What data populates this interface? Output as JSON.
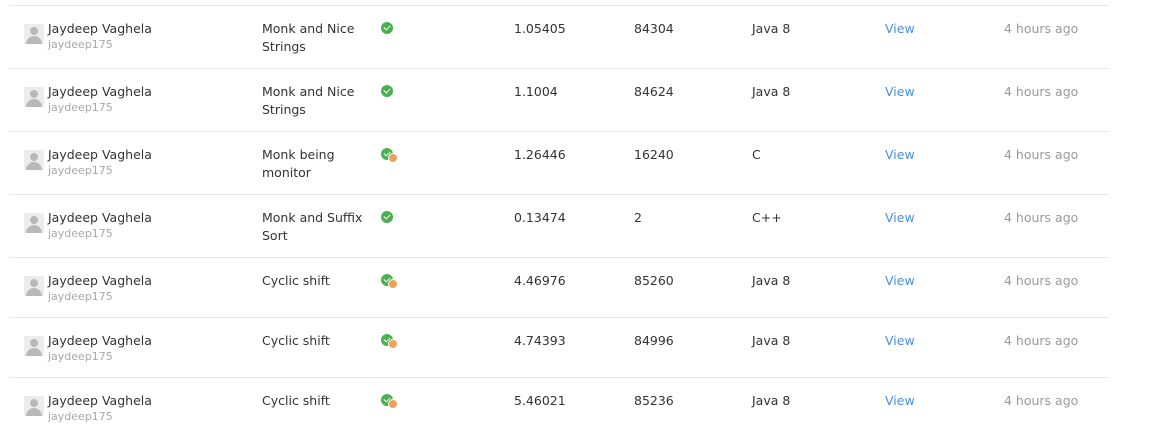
{
  "colors": {
    "accent_link": "#4a90d9",
    "accepted": "#4caf50",
    "partial": "#f0a05a",
    "divider": "#e6e6e6",
    "muted_text": "#9a9a9a"
  },
  "rows": [
    {
      "user_name": "Jaydeep Vaghela",
      "user_handle": "jaydeep175",
      "problem": "Monk and Nice Strings",
      "status_icon": "accepted-icon",
      "time": "1.05405",
      "memory": "84304",
      "language": "Java 8",
      "view_label": "View",
      "submitted": "4 hours ago"
    },
    {
      "user_name": "Jaydeep Vaghela",
      "user_handle": "jaydeep175",
      "problem": "Monk and Nice Strings",
      "status_icon": "accepted-icon",
      "time": "1.1004",
      "memory": "84624",
      "language": "Java 8",
      "view_label": "View",
      "submitted": "4 hours ago"
    },
    {
      "user_name": "Jaydeep Vaghela",
      "user_handle": "jaydeep175",
      "problem": "Monk being monitor",
      "status_icon": "partially-accepted-icon",
      "time": "1.26446",
      "memory": "16240",
      "language": "C",
      "view_label": "View",
      "submitted": "4 hours ago"
    },
    {
      "user_name": "Jaydeep Vaghela",
      "user_handle": "jaydeep175",
      "problem": "Monk and Suffix Sort",
      "status_icon": "accepted-icon",
      "time": "0.13474",
      "memory": "2",
      "language": "C++",
      "view_label": "View",
      "submitted": "4 hours ago"
    },
    {
      "user_name": "Jaydeep Vaghela",
      "user_handle": "jaydeep175",
      "problem": "Cyclic shift",
      "status_icon": "partially-accepted-icon",
      "time": "4.46976",
      "memory": "85260",
      "language": "Java 8",
      "view_label": "View",
      "submitted": "4 hours ago"
    },
    {
      "user_name": "Jaydeep Vaghela",
      "user_handle": "jaydeep175",
      "problem": "Cyclic shift",
      "status_icon": "partially-accepted-icon",
      "time": "4.74393",
      "memory": "84996",
      "language": "Java 8",
      "view_label": "View",
      "submitted": "4 hours ago"
    },
    {
      "user_name": "Jaydeep Vaghela",
      "user_handle": "jaydeep175",
      "problem": "Cyclic shift",
      "status_icon": "partially-accepted-icon",
      "time": "5.46021",
      "memory": "85236",
      "language": "Java 8",
      "view_label": "View",
      "submitted": "4 hours ago"
    }
  ]
}
